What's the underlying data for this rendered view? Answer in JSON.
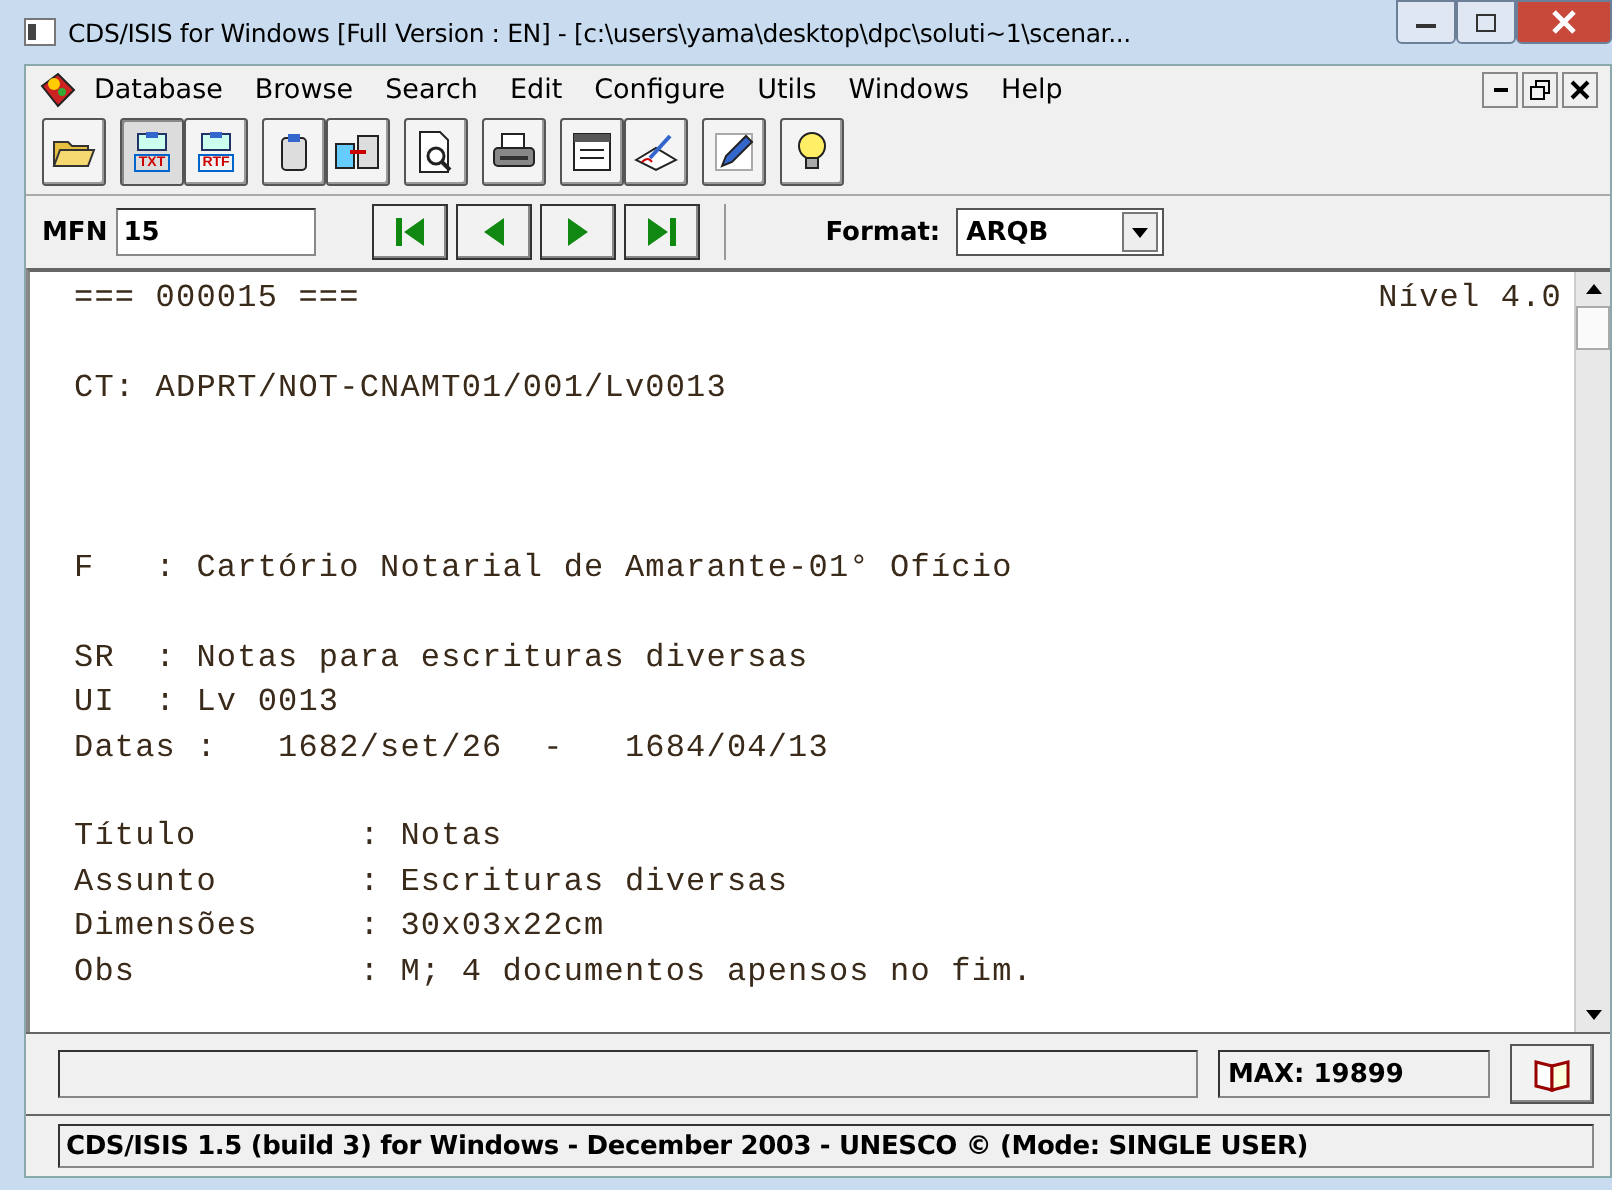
{
  "window": {
    "title": "CDS/ISIS for Windows [Full Version : EN] - [c:\\users\\yama\\desktop\\dpc\\soluti~1\\scenar..."
  },
  "menu": [
    "Database",
    "Browse",
    "Search",
    "Edit",
    "Configure",
    "Utils",
    "Windows",
    "Help"
  ],
  "toolbar": [
    [
      {
        "kind": "open"
      }
    ],
    [
      {
        "kind": "doc",
        "label": "TXT",
        "selected": true
      },
      {
        "kind": "doc",
        "label": "RTF",
        "selected": false
      }
    ],
    [
      {
        "kind": "clip"
      },
      {
        "kind": "copy"
      }
    ],
    [
      {
        "kind": "preview"
      }
    ],
    [
      {
        "kind": "print"
      }
    ],
    [
      {
        "kind": "form"
      },
      {
        "kind": "sign"
      }
    ],
    [
      {
        "kind": "pencil"
      }
    ],
    [
      {
        "kind": "bulb"
      }
    ]
  ],
  "navigation": {
    "mfn_label": "MFN",
    "mfn_value": "15",
    "buttons": [
      {
        "kind": "first"
      },
      {
        "kind": "prev"
      },
      {
        "kind": "next"
      },
      {
        "kind": "last"
      }
    ],
    "format_label": "Format:",
    "format_value": "ARQB"
  },
  "record": {
    "header": "=== 000015 ===",
    "level": "Nível 4.0",
    "blocks": [
      {
        "kind": "normal",
        "lines": [
          "CT: ADPRT/NOT-CNAMT01/001/Lv0013"
        ]
      },
      {
        "kind": "wide",
        "lines": [
          "F   : Cartório Notarial de Amarante-01° Ofício"
        ]
      },
      {
        "kind": "normal",
        "lines": [
          "SR  : Notas para escrituras diversas",
          "UI  : Lv 0013",
          "Datas :   1682/set/26  -   1684/04/13"
        ]
      },
      {
        "kind": "normal",
        "lines": [
          "Título        : Notas",
          "Assunto       : Escrituras diversas",
          "Dimensões     : 30x03x22cm",
          "Obs           : M; 4 documentos apensos no fim."
        ]
      }
    ]
  },
  "status": {
    "max": "MAX: 19899"
  },
  "footer": "CDS/ISIS 1.5 (build 3) for Windows - December 2003 - UNESCO © (Mode: SINGLE USER)"
}
